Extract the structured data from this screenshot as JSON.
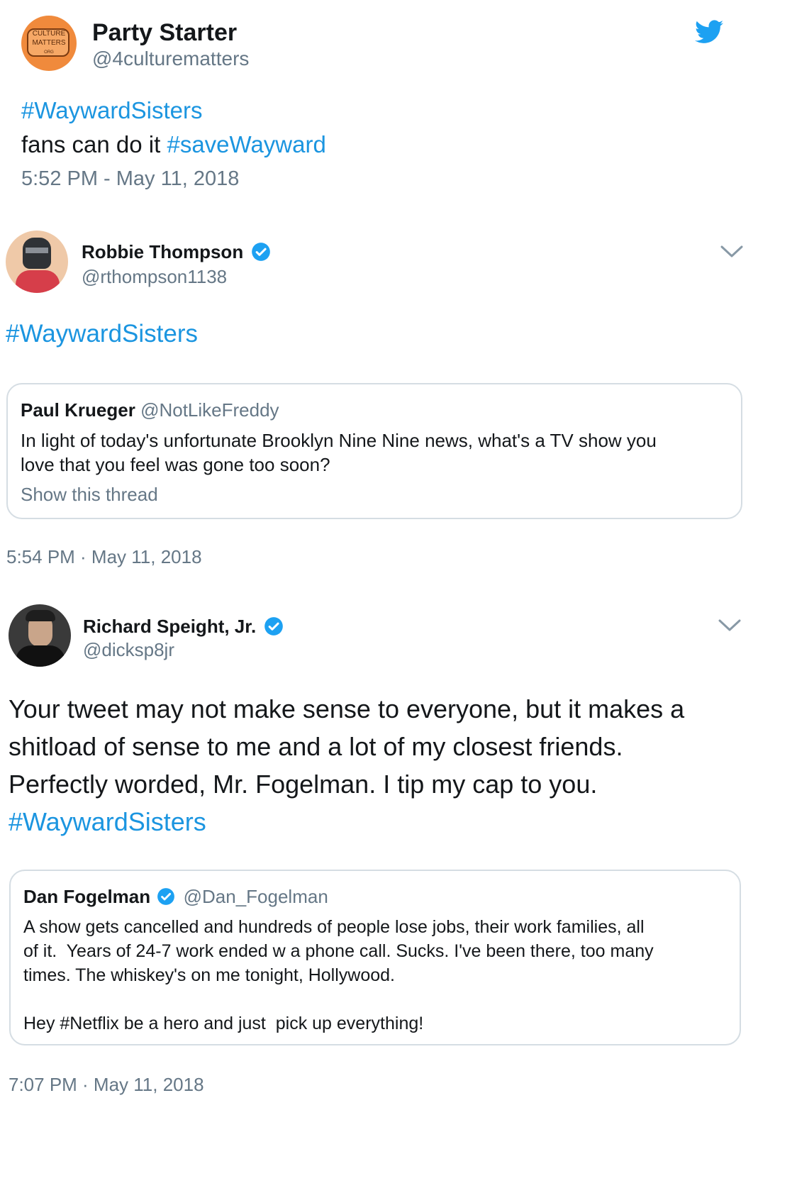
{
  "tweets": [
    {
      "name": "Party Starter",
      "handle": "@4culturematters",
      "avatar_text": [
        "CULTURE",
        "MATTERS",
        "ORG"
      ],
      "text_line1_hashtag": "#WaywardSisters",
      "text_line2_prefix": "fans can do it ",
      "text_line2_hashtag": "#saveWayward",
      "timestamp": "5:52 PM - May 11, 2018",
      "brand_icon": "twitter-bird-icon"
    },
    {
      "name": "Robbie Thompson",
      "handle": "@rthompson1138",
      "verified": true,
      "text_hashtag": "#WaywardSisters",
      "quote": {
        "name": "Paul Krueger",
        "handle": "@NotLikeFreddy",
        "line1": "In light of today's unfortunate Brooklyn Nine Nine news, what's a TV show you",
        "line2": "love that you feel was gone too soon?",
        "thread_link": "Show this thread"
      },
      "timestamp": "5:54 PM · May 11, 2018"
    },
    {
      "name": "Richard Speight, Jr.",
      "handle": "@dicksp8jr",
      "verified": true,
      "text_lines": [
        "Your tweet may not make sense to everyone, but it makes a",
        "shitload of sense to me and a lot of my closest friends.",
        "Perfectly worded, Mr. Fogelman. I tip my cap to you."
      ],
      "text_hashtag": "#WaywardSisters",
      "quote": {
        "name": "Dan Fogelman",
        "handle": "@Dan_Fogelman",
        "verified": true,
        "lines": [
          "A show gets cancelled and hundreds of people lose jobs, their work families, all",
          "of it.  Years of 24-7 work ended w a phone call. Sucks. I've been there, too many",
          "times. The whiskey's on me tonight, Hollywood."
        ],
        "last_line": "Hey #Netflix be a hero and just  pick up everything!"
      },
      "timestamp": "7:07 PM · May 11, 2018"
    }
  ],
  "colors": {
    "link": "#1b95e0",
    "muted": "#657786",
    "border": "#d5dde3",
    "verified": "#1da1f2",
    "culture_orange": "#f08a3c"
  }
}
